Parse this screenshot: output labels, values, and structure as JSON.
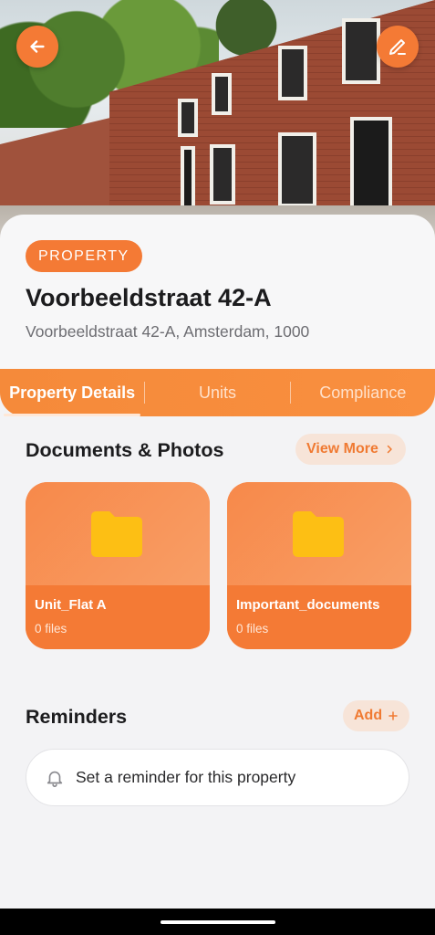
{
  "header": {
    "back_icon": "arrow-left-icon",
    "edit_icon": "pencil-icon",
    "accent_color": "#f47a35"
  },
  "property": {
    "badge": "PROPERTY",
    "name": "Voorbeeldstraat 42-A",
    "address": "Voorbeeldstraat 42-A, Amsterdam, 1000"
  },
  "tabs": [
    {
      "label": "Property Details",
      "active": true
    },
    {
      "label": "Units",
      "active": false
    },
    {
      "label": "Compliance",
      "active": false
    }
  ],
  "documents": {
    "title": "Documents & Photos",
    "view_more": "View More",
    "folders": [
      {
        "name": "Unit_Flat A",
        "count": "0 files"
      },
      {
        "name": "Important_documents",
        "count": "0 files"
      }
    ]
  },
  "reminders": {
    "title": "Reminders",
    "add_label": "Add",
    "placeholder": "Set a reminder for this property"
  }
}
